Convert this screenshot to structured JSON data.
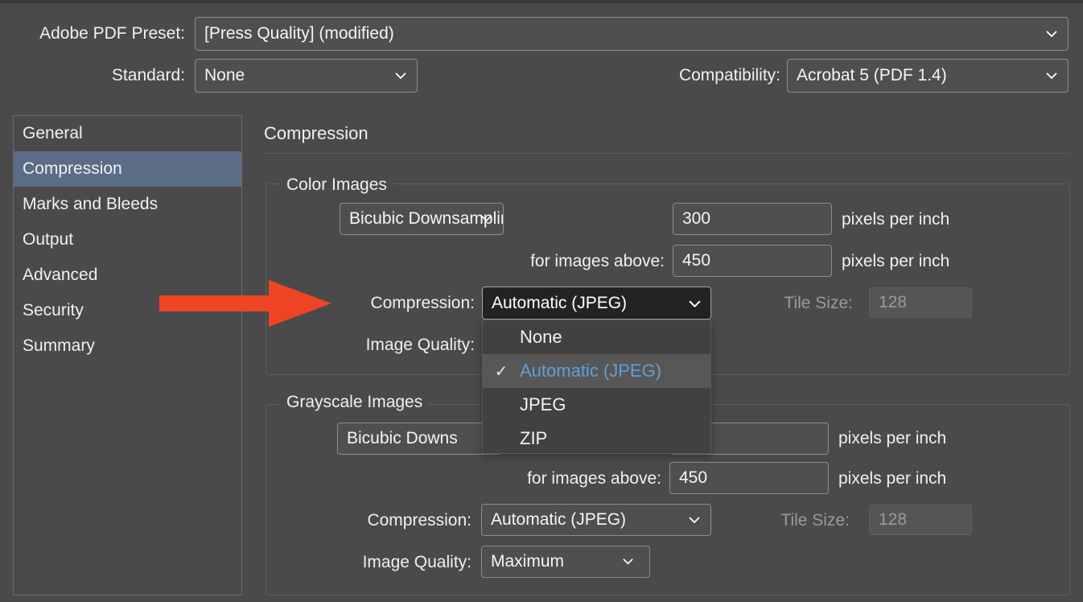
{
  "dialog": {
    "preset_label": "Adobe PDF Preset:",
    "preset_value": "[Press Quality] (modified)",
    "standard_label": "Standard:",
    "standard_value": "None",
    "compatibility_label": "Compatibility:",
    "compatibility_value": "Acrobat 5 (PDF 1.4)"
  },
  "sidebar": {
    "items": [
      {
        "label": "General",
        "selected": false
      },
      {
        "label": "Compression",
        "selected": true
      },
      {
        "label": "Marks and Bleeds",
        "selected": false
      },
      {
        "label": "Output",
        "selected": false
      },
      {
        "label": "Advanced",
        "selected": false
      },
      {
        "label": "Security",
        "selected": false
      },
      {
        "label": "Summary",
        "selected": false
      }
    ]
  },
  "panel": {
    "title": "Compression",
    "color_images": {
      "legend": "Color Images",
      "downsample_value": "Bicubic Downsampling to",
      "ppi_value": "300",
      "ppi_unit": "pixels per inch",
      "above_label": "for images above:",
      "above_value": "450",
      "above_unit": "pixels per inch",
      "compression_label": "Compression:",
      "compression_value": "Automatic (JPEG)",
      "tile_size_label": "Tile Size:",
      "tile_size_value": "128",
      "image_quality_label": "Image Quality:"
    },
    "grayscale_images": {
      "legend": "Grayscale Images",
      "downsample_value": "Bicubic Downs",
      "ppi_unit": "pixels per inch",
      "above_label": "for images above:",
      "above_value": "450",
      "above_unit": "pixels per inch",
      "compression_label": "Compression:",
      "compression_value": "Automatic (JPEG)",
      "tile_size_label": "Tile Size:",
      "tile_size_value": "128",
      "image_quality_label": "Image Quality:",
      "image_quality_value": "Maximum"
    }
  },
  "compression_menu": {
    "open": true,
    "selected": "Automatic (JPEG)",
    "checkmark": "✓",
    "items": [
      {
        "label": "None",
        "checked": false,
        "highlighted": false
      },
      {
        "label": "Automatic (JPEG)",
        "checked": true,
        "highlighted": true
      },
      {
        "label": "JPEG",
        "checked": false,
        "highlighted": false
      },
      {
        "label": "ZIP",
        "checked": false,
        "highlighted": false
      }
    ]
  },
  "annotation": {
    "arrow_name": "red-pointer-arrow",
    "arrow_color": "#ee4424"
  },
  "colors": {
    "window_bg": "#4a4a4a",
    "selection_blue": "#5a6c86",
    "menu_bg": "#414141",
    "menu_highlight": "#575757",
    "menu_highlight_text": "#5f9fd6",
    "field_bg": "#4f4f4f",
    "field_border": "#8e8e8e",
    "combo_open_bg": "#232323",
    "disabled_text": "#9b9b9b",
    "accent_red": "#ee4424"
  }
}
